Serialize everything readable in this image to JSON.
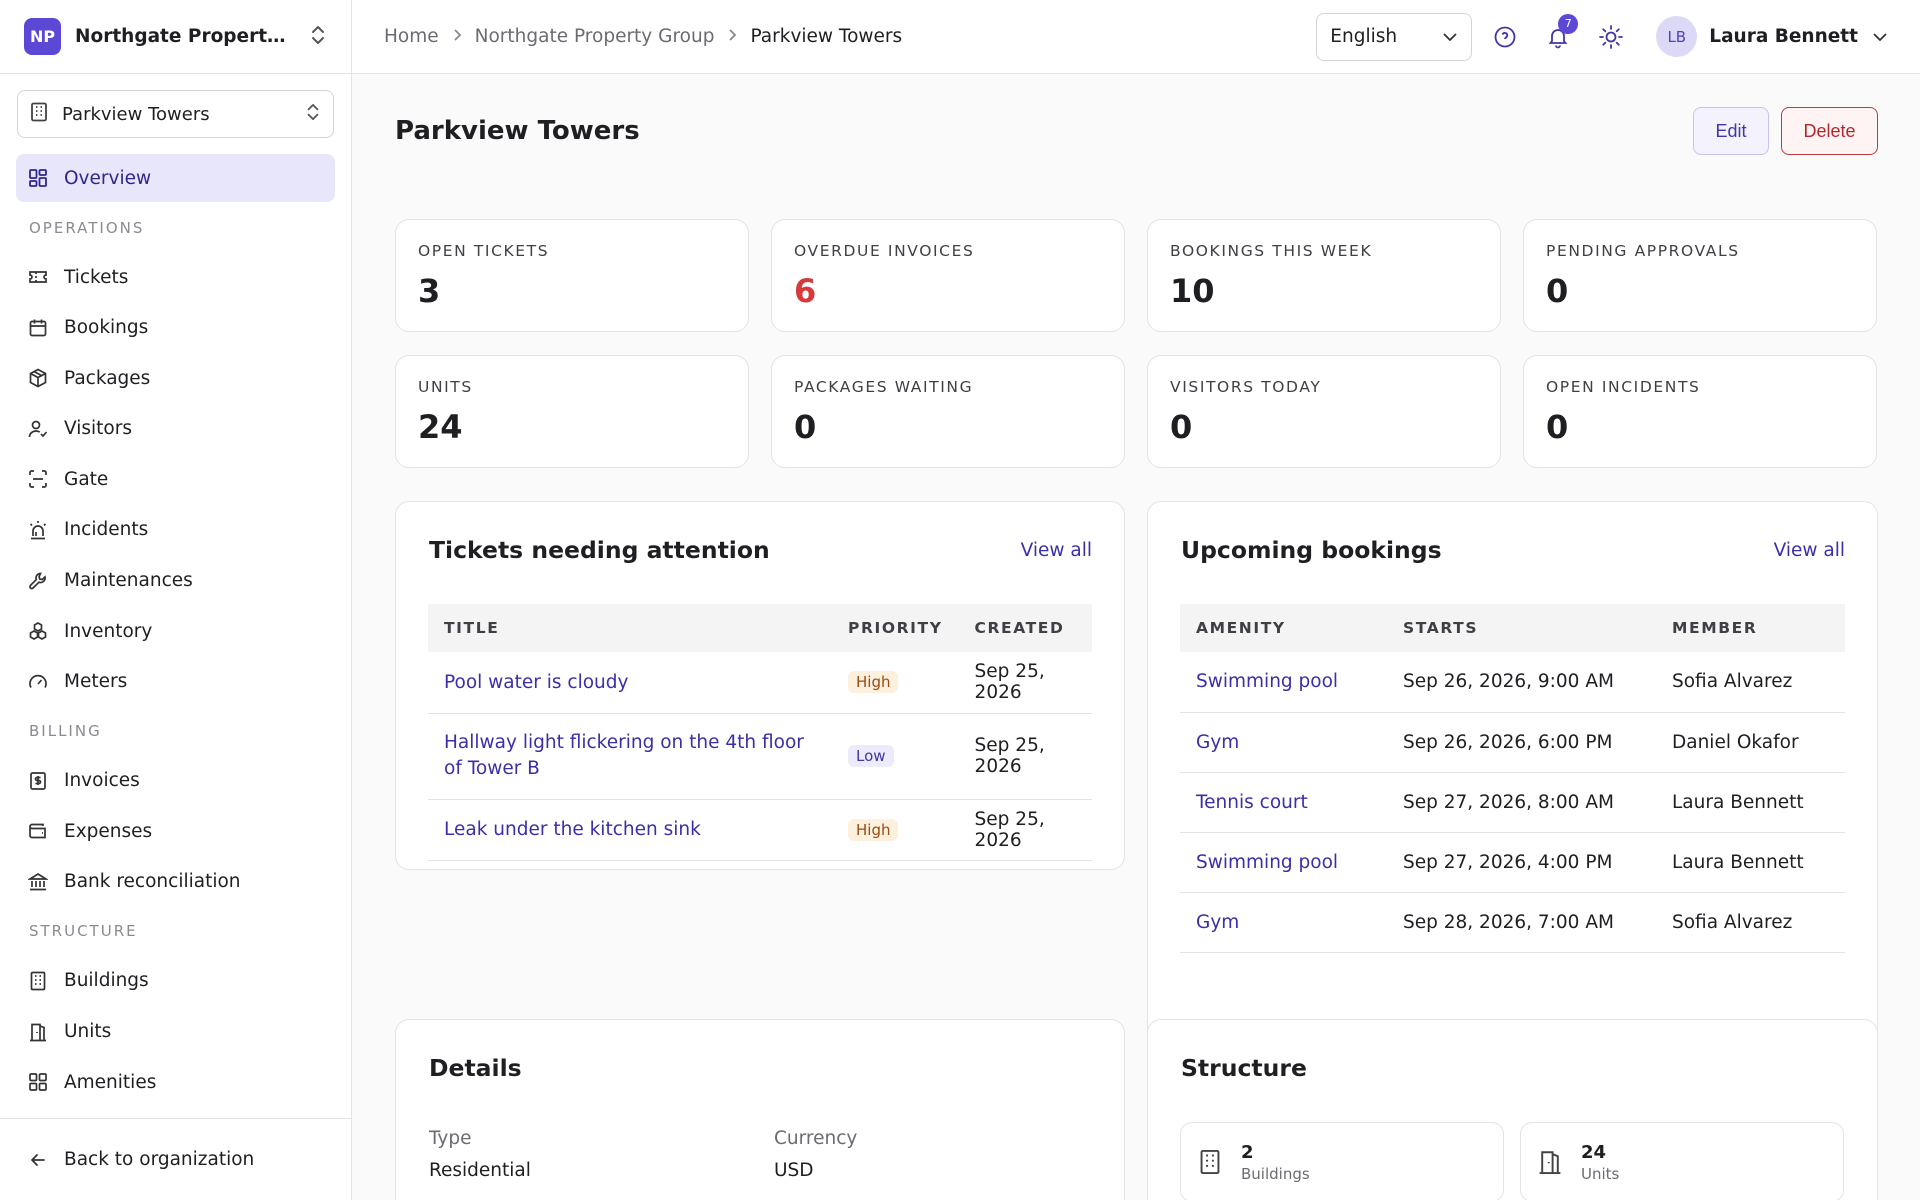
{
  "org": {
    "initials": "NP",
    "name": "Northgate Property Gr..."
  },
  "property_selector": {
    "label": "Parkview Towers"
  },
  "nav": {
    "overview": "Overview",
    "sections": {
      "operations": "OPERATIONS",
      "billing": "BILLING",
      "structure": "STRUCTURE"
    },
    "operations": [
      "Tickets",
      "Bookings",
      "Packages",
      "Visitors",
      "Gate",
      "Incidents",
      "Maintenances",
      "Inventory",
      "Meters"
    ],
    "billing": [
      "Invoices",
      "Expenses",
      "Bank reconciliation"
    ],
    "structure": [
      "Buildings",
      "Units",
      "Amenities"
    ],
    "back": "Back to organization"
  },
  "breadcrumb": [
    "Home",
    "Northgate Property Group",
    "Parkview Towers"
  ],
  "topbar": {
    "language": "English",
    "notifications_count": "7",
    "user_initials": "LB",
    "user_name": "Laura Bennett"
  },
  "page": {
    "title": "Parkview Towers",
    "edit": "Edit",
    "delete": "Delete"
  },
  "stats": [
    {
      "label": "OPEN TICKETS",
      "value": "3"
    },
    {
      "label": "OVERDUE INVOICES",
      "value": "6"
    },
    {
      "label": "BOOKINGS THIS WEEK",
      "value": "10"
    },
    {
      "label": "PENDING APPROVALS",
      "value": "0"
    },
    {
      "label": "UNITS",
      "value": "24"
    },
    {
      "label": "PACKAGES WAITING",
      "value": "0"
    },
    {
      "label": "VISITORS TODAY",
      "value": "0"
    },
    {
      "label": "OPEN INCIDENTS",
      "value": "0"
    }
  ],
  "tickets": {
    "title": "Tickets needing attention",
    "view_all": "View all",
    "columns": [
      "TITLE",
      "PRIORITY",
      "CREATED"
    ],
    "rows": [
      {
        "title": "Pool water is cloudy",
        "priority": "High",
        "created": "Sep 25, 2026"
      },
      {
        "title": "Hallway light flickering on the 4th floor of Tower B",
        "priority": "Low",
        "created": "Sep 25, 2026"
      },
      {
        "title": "Leak under the kitchen sink",
        "priority": "High",
        "created": "Sep 25, 2026"
      }
    ]
  },
  "bookings": {
    "title": "Upcoming bookings",
    "view_all": "View all",
    "columns": [
      "AMENITY",
      "STARTS",
      "MEMBER"
    ],
    "rows": [
      {
        "amenity": "Swimming pool",
        "starts": "Sep 26, 2026, 9:00 AM",
        "member": "Sofia Alvarez"
      },
      {
        "amenity": "Gym",
        "starts": "Sep 26, 2026, 6:00 PM",
        "member": "Daniel Okafor"
      },
      {
        "amenity": "Tennis court",
        "starts": "Sep 27, 2026, 8:00 AM",
        "member": "Laura Bennett"
      },
      {
        "amenity": "Swimming pool",
        "starts": "Sep 27, 2026, 4:00 PM",
        "member": "Laura Bennett"
      },
      {
        "amenity": "Gym",
        "starts": "Sep 28, 2026, 7:00 AM",
        "member": "Sofia Alvarez"
      }
    ]
  },
  "details": {
    "title": "Details",
    "type_label": "Type",
    "type_value": "Residential",
    "currency_label": "Currency",
    "currency_value": "USD"
  },
  "structure": {
    "title": "Structure",
    "buildings_count": "2",
    "buildings_label": "Buildings",
    "units_count": "24",
    "units_label": "Units"
  },
  "colors": {
    "accent": "#5b49d6",
    "danger": "#d63a3a",
    "link": "#3b2fa8"
  }
}
